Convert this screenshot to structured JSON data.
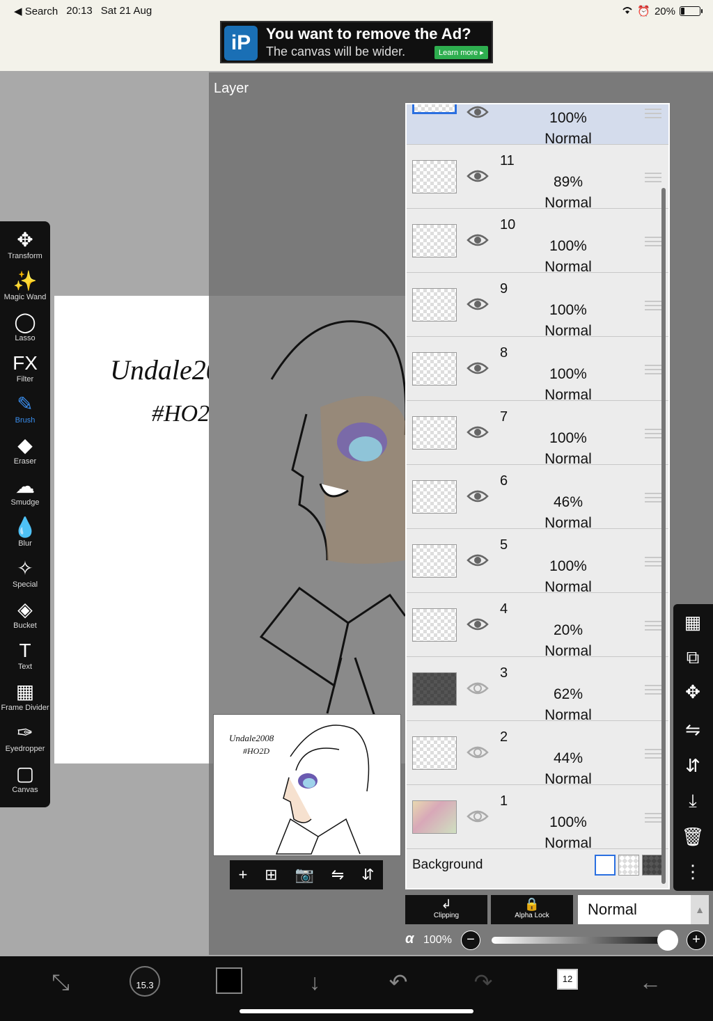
{
  "status_bar": {
    "back": "◀ Search",
    "time": "20:13",
    "date": "Sat 21 Aug",
    "battery": "20%",
    "battery_level": 0.2
  },
  "ad": {
    "title": "You want to remove the Ad?",
    "subtitle": "The canvas will be wider.",
    "cta": "Learn more ▸"
  },
  "panel": {
    "title": "Layer"
  },
  "canvas_text": {
    "signature_line1": "Undale2008",
    "signature_line2": "#HO2D"
  },
  "layers": [
    {
      "name": "",
      "opacity": "100%",
      "blend": "Normal",
      "visible": true,
      "selected": true
    },
    {
      "name": "11",
      "opacity": "89%",
      "blend": "Normal",
      "visible": true
    },
    {
      "name": "10",
      "opacity": "100%",
      "blend": "Normal",
      "visible": true
    },
    {
      "name": "9",
      "opacity": "100%",
      "blend": "Normal",
      "visible": true
    },
    {
      "name": "8",
      "opacity": "100%",
      "blend": "Normal",
      "visible": true
    },
    {
      "name": "7",
      "opacity": "100%",
      "blend": "Normal",
      "visible": true
    },
    {
      "name": "6",
      "opacity": "46%",
      "blend": "Normal",
      "visible": true
    },
    {
      "name": "5",
      "opacity": "100%",
      "blend": "Normal",
      "visible": true
    },
    {
      "name": "4",
      "opacity": "20%",
      "blend": "Normal",
      "visible": true
    },
    {
      "name": "3",
      "opacity": "62%",
      "blend": "Normal",
      "visible": false
    },
    {
      "name": "2",
      "opacity": "44%",
      "blend": "Normal",
      "visible": false
    },
    {
      "name": "1",
      "opacity": "100%",
      "blend": "Normal",
      "visible": false
    }
  ],
  "background_row": {
    "label": "Background"
  },
  "layer_controls": {
    "clipping": "Clipping",
    "alpha_lock": "Alpha Lock",
    "blend_mode": "Normal",
    "alpha_symbol": "α",
    "alpha_value": "100%"
  },
  "left_tools": [
    {
      "icon": "transform-icon",
      "label": "Transform",
      "glyph": "✥"
    },
    {
      "icon": "magic-wand-icon",
      "label": "Magic Wand",
      "glyph": "✨"
    },
    {
      "icon": "lasso-icon",
      "label": "Lasso",
      "glyph": "◯"
    },
    {
      "icon": "filter-icon",
      "label": "Filter",
      "glyph": "FX"
    },
    {
      "icon": "brush-icon",
      "label": "Brush",
      "glyph": "✎",
      "active": true
    },
    {
      "icon": "eraser-icon",
      "label": "Eraser",
      "glyph": "◆"
    },
    {
      "icon": "smudge-icon",
      "label": "Smudge",
      "glyph": "☁"
    },
    {
      "icon": "blur-icon",
      "label": "Blur",
      "glyph": "💧"
    },
    {
      "icon": "special-icon",
      "label": "Special",
      "glyph": "✧"
    },
    {
      "icon": "bucket-icon",
      "label": "Bucket",
      "glyph": "◈"
    },
    {
      "icon": "text-icon",
      "label": "Text",
      "glyph": "T"
    },
    {
      "icon": "frame-divider-icon",
      "label": "Frame Divider",
      "glyph": "▦"
    },
    {
      "icon": "eyedropper-icon",
      "label": "Eyedropper",
      "glyph": "✑"
    },
    {
      "icon": "canvas-icon",
      "label": "Canvas",
      "glyph": "▢"
    }
  ],
  "bottom_bar": {
    "brush_size": "15.3",
    "layer_count": "12",
    "primary_color": "#000000"
  },
  "colors": {
    "accent": "#3a8ff0",
    "selected_layer": "#d4dcec",
    "toolbar": "#111111"
  }
}
